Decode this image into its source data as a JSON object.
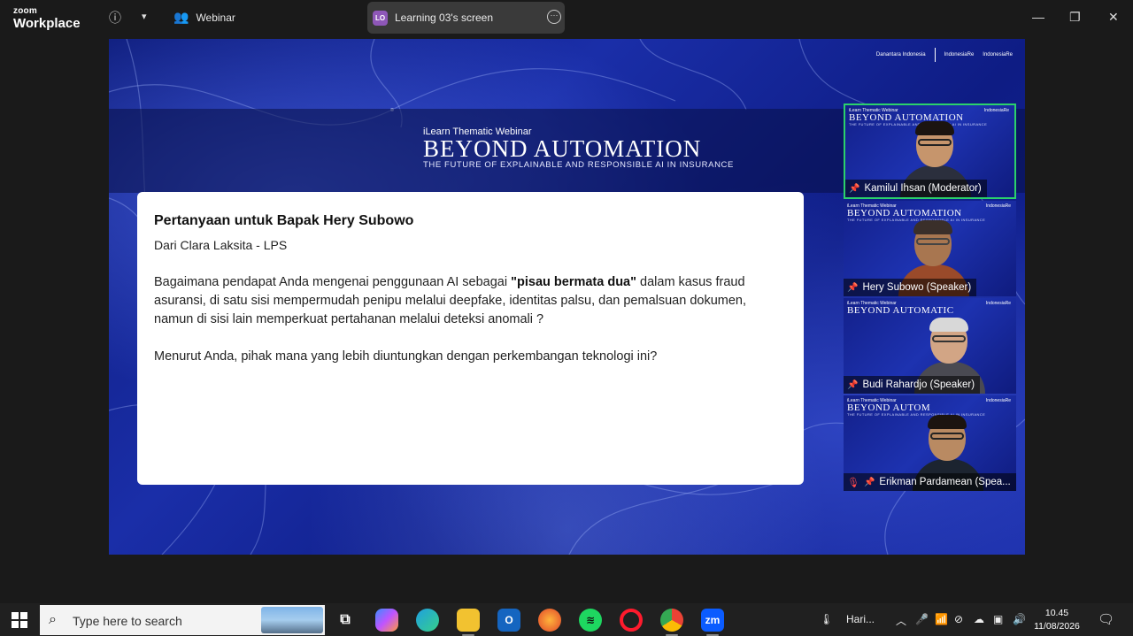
{
  "titlebar": {
    "logo_line1": "zoom",
    "logo_line2": "Workplace",
    "meeting_type": "Webinar",
    "share_badge": "LO",
    "share_title": "Learning 03's screen"
  },
  "slide": {
    "brand_logos": [
      "Danantara Indonesia",
      "IndonesiaRe",
      "IndonesiaRe"
    ],
    "subtitle": "iLearn Thematic Webinar",
    "title": "BEYOND AUTOMATION",
    "tagline": "THE FUTURE OF EXPLAINABLE AND RESPONSIBLE AI IN INSURANCE",
    "question_title": "Pertanyaan untuk Bapak Hery Subowo",
    "question_from": "Dari Clara Laksita - LPS",
    "question_body_before": "Bagaimana pendapat Anda mengenai penggunaan AI sebagai ",
    "question_body_bold": "\"pisau bermata dua\"",
    "question_body_after": " dalam kasus fraud asuransi, di satu sisi mempermudah penipu melalui deepfake, identitas palsu, dan pemalsuan dokumen, namun di sisi lain memperkuat pertahanan melalui deteksi anomali ?",
    "question_body2": "Menurut Anda, pihak mana yang lebih diuntungkan dengan perkembangan teknologi ini?"
  },
  "tiles": [
    {
      "name": "Kamilul Ihsan (Moderator)",
      "active": true,
      "mic_off": false
    },
    {
      "name": "Hery Subowo (Speaker)",
      "active": false,
      "mic_off": false
    },
    {
      "name": "Budi Rahardjo (Speaker)",
      "active": false,
      "mic_off": false
    },
    {
      "name": "Erikman Pardamean (Spea...",
      "active": false,
      "mic_off": true
    }
  ],
  "tile_header": {
    "a": "iLearn Thematic Webinar",
    "b": "BEYOND AUTOMATION",
    "b_cut": "BEYOND AUTOMATIC",
    "b_cut2": "BEYOND AUTOM",
    "c": "THE FUTURE OF EXPLAINABLE AND RESPONSIBLE AI IN INSURANCE"
  },
  "taskbar": {
    "search_placeholder": "Type here to search",
    "weather": "Hari...",
    "time": "10.45",
    "date": "11/08/2026",
    "apps": [
      "task-view",
      "copilot",
      "edge",
      "file-explorer",
      "outlook",
      "firefox",
      "spotify",
      "opera",
      "chrome",
      "zoom"
    ]
  },
  "colors": {
    "active_speaker_border": "#2bd16b",
    "share_badge": "#8e57b8",
    "slide_bg": "#1a2ea8"
  }
}
